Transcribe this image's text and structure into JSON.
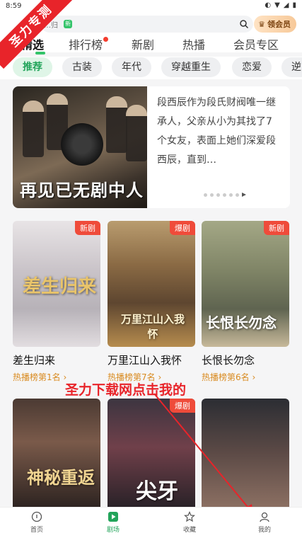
{
  "status": {
    "time": "8:59"
  },
  "search": {
    "text": "…归",
    "tag": "新"
  },
  "vip": {
    "label": "领会员"
  },
  "tabs": [
    {
      "label": "精选"
    },
    {
      "label": "排行榜"
    },
    {
      "label": "新剧"
    },
    {
      "label": "热播"
    },
    {
      "label": "会员专区"
    }
  ],
  "chips": [
    "推荐",
    "古装",
    "年代",
    "穿越重生",
    "恋爱",
    "逆"
  ],
  "banner": {
    "poster_title": "再见已无剧中人",
    "description": "段西辰作为段氏财阀唯一继承人，父亲从小为其找了7个女友，表面上她们深爱段西辰，直到…"
  },
  "cards_row1": [
    {
      "title": "差生归来",
      "rank": "热播榜第1名",
      "badge": "新剧",
      "poster_text": "差生归来"
    },
    {
      "title": "万里江山入我怀",
      "rank": "热播榜第7名",
      "badge": "爆剧",
      "poster_text": "万里江山入我怀"
    },
    {
      "title": "长恨长勿念",
      "rank": "热播榜第6名",
      "badge": "新剧",
      "poster_text": "长恨长勿念"
    }
  ],
  "cards_row2": [
    {
      "badge": "",
      "poster_text": "神秘重返"
    },
    {
      "badge": "爆剧",
      "poster_text": "尖牙"
    },
    {
      "badge": "",
      "poster_text": ""
    }
  ],
  "watermark": {
    "corner": "圣力专测",
    "text": "圣力下载网点击我的"
  },
  "nav": [
    {
      "label": "首页"
    },
    {
      "label": "剧场"
    },
    {
      "label": "收藏"
    },
    {
      "label": "我的"
    }
  ],
  "colors": {
    "accent": "#34c46a",
    "badge": "#ef4b3a",
    "rank": "#d98b21",
    "watermark": "#e8242a"
  }
}
